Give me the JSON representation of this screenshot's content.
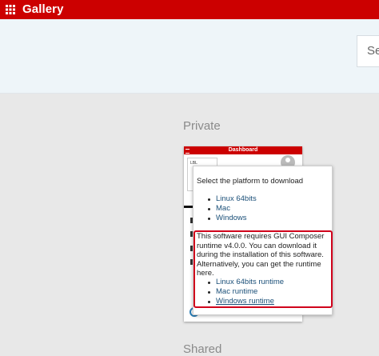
{
  "app": {
    "title": "Gallery"
  },
  "search": {
    "text": "Se"
  },
  "sections": {
    "private": "Private",
    "bottom_partial": "Shared"
  },
  "card": {
    "thumbnail_title": "Dashboard",
    "thumbnail_panel_label": "LBL"
  },
  "popover": {
    "title": "Select the platform to download",
    "platforms": [
      "Linux 64bits",
      "Mac",
      "Windows"
    ],
    "runtime_message": "This software requires GUI Composer runtime v4.0.0. You can download it during the installation of this software. Alternatively, you can get the runtime here.",
    "runtimes": [
      "Linux 64bits runtime",
      "Mac runtime",
      "Windows runtime"
    ]
  },
  "colors": {
    "brand": "#cc0000",
    "link": "#1a4f78",
    "highlight": "#d0021b"
  }
}
